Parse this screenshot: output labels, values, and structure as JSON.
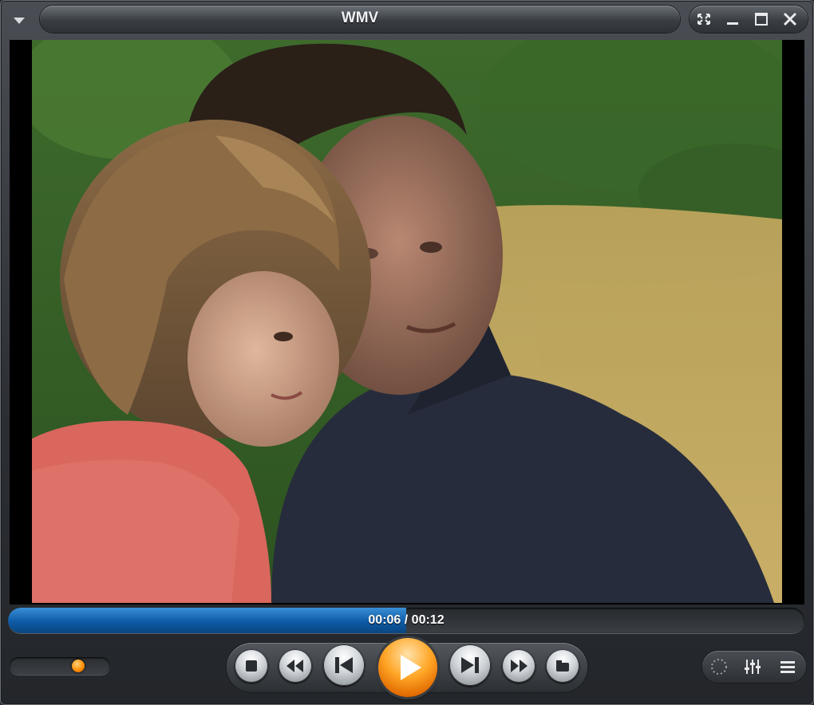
{
  "window": {
    "title": "WMV"
  },
  "playback": {
    "time_display": "00:06 / 00:12",
    "progress": 0.5,
    "volume": 0.72,
    "state": "paused"
  },
  "colors": {
    "accent_orange": "#ff9a1a",
    "seek_blue": "#0e5aa6",
    "chrome_dark": "#2b2e32"
  },
  "icons": {
    "menu": "dropdown-arrow-icon",
    "fullscreen": "fullscreen-icon",
    "minimize": "minimize-icon",
    "maximize": "maximize-icon",
    "close": "close-icon",
    "stop": "stop-icon",
    "rewind": "rewind-icon",
    "previous": "skip-previous-icon",
    "play": "play-icon",
    "next": "skip-next-icon",
    "fast_forward": "fast-forward-icon",
    "open": "eject-open-icon",
    "visualization": "dotted-circle-icon",
    "equalizer": "equalizer-icon",
    "playlist": "playlist-icon"
  }
}
